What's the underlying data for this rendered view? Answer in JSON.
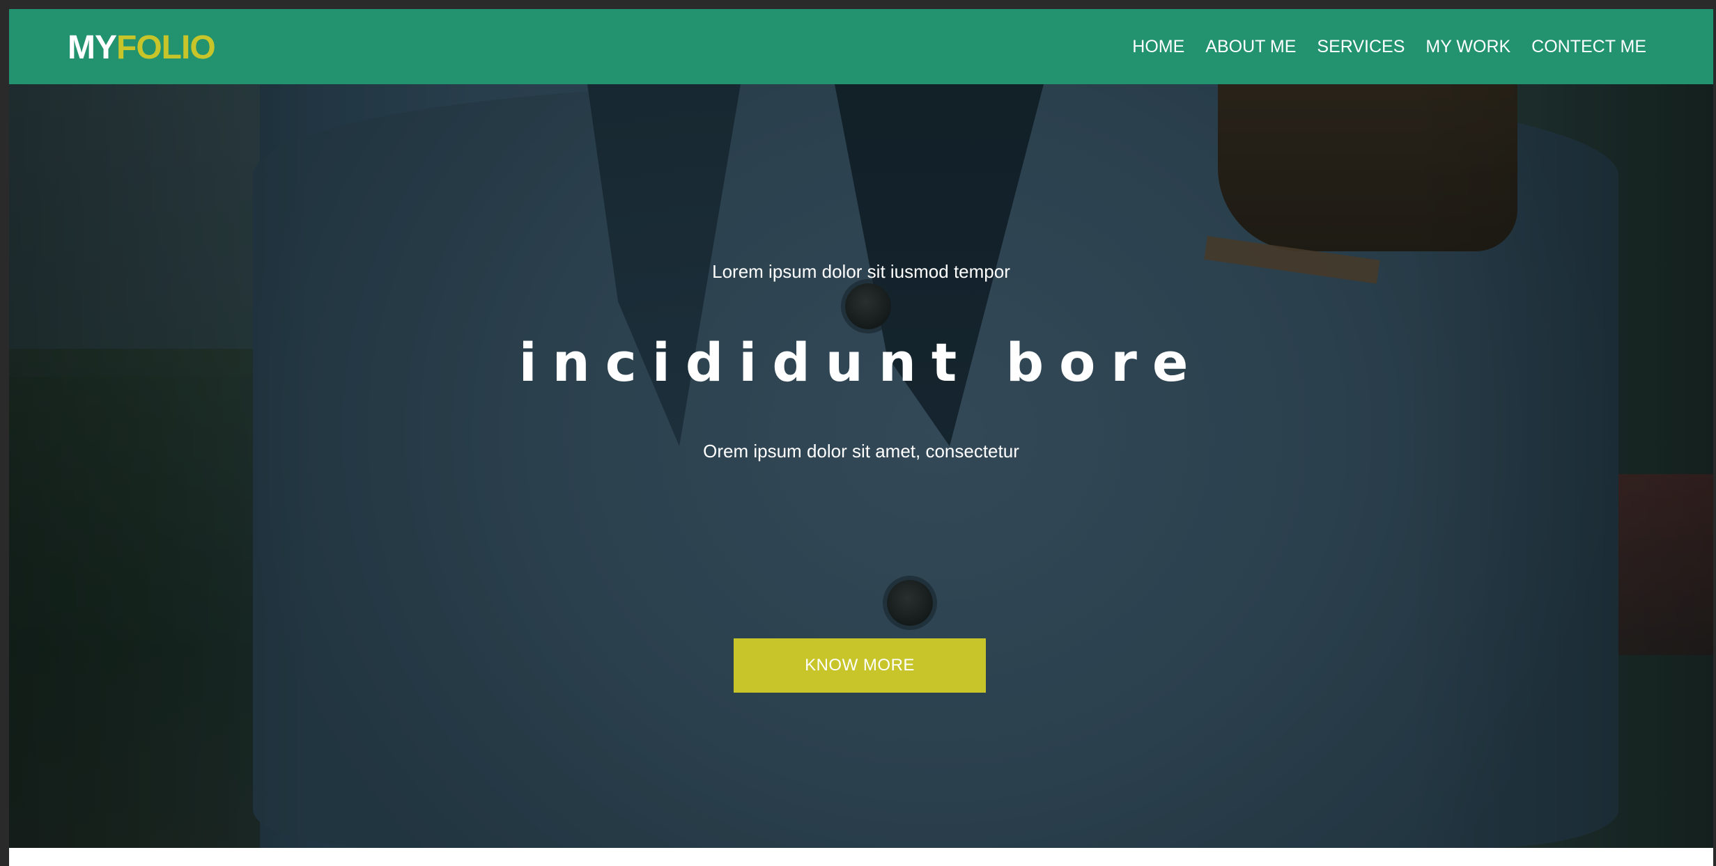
{
  "brand": {
    "logo_part1": "MY",
    "logo_part2": "FOLIO"
  },
  "nav": {
    "items": [
      {
        "label": "HOME"
      },
      {
        "label": "ABOUT ME"
      },
      {
        "label": "SERVICES"
      },
      {
        "label": "MY WORK"
      },
      {
        "label": "CONTECT ME"
      }
    ]
  },
  "hero": {
    "subtitle": "Lorem ipsum dolor sit iusmod tempor",
    "title": "incididunt bore",
    "text": "Orem ipsum dolor sit amet, consectetur",
    "cta_label": "KNOW MORE"
  },
  "colors": {
    "navbar_bg": "#22936e",
    "accent": "#c8c52a",
    "text": "#ffffff"
  },
  "icons": [
    "hero-background-image"
  ]
}
